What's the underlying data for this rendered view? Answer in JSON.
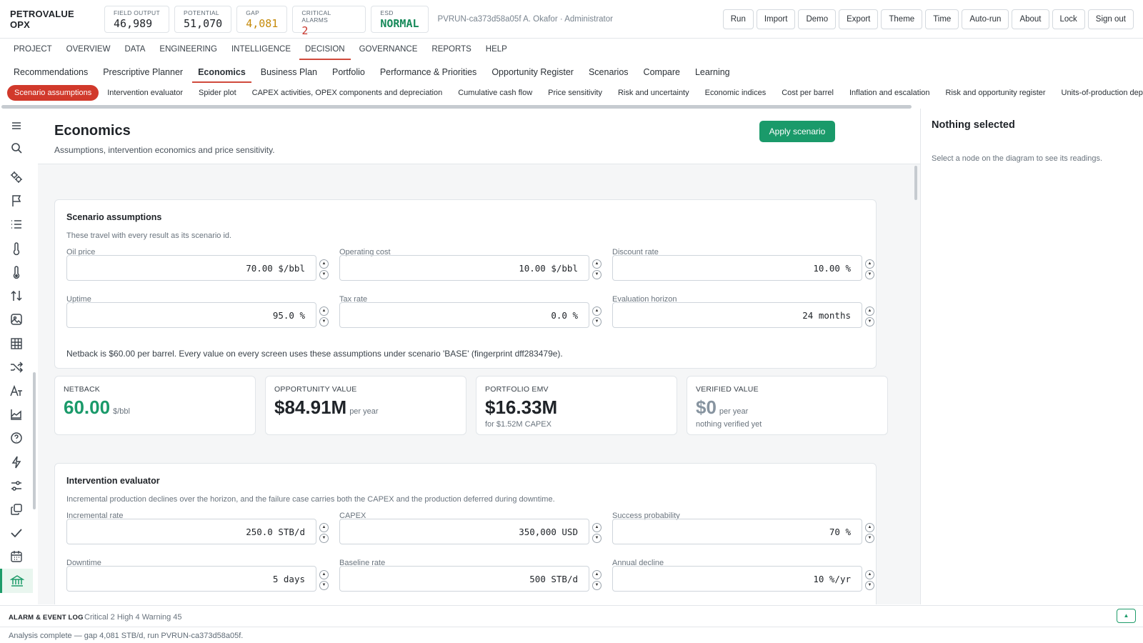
{
  "brand": "PETROVALUE OPX",
  "kpis": [
    {
      "label": "FIELD OUTPUT",
      "value": "46,989",
      "tone": "normal"
    },
    {
      "label": "POTENTIAL",
      "value": "51,070",
      "tone": "normal"
    },
    {
      "label": "GAP",
      "value": "4,081",
      "tone": "amber"
    },
    {
      "label": "CRITICAL ALARMS",
      "value": "2",
      "tone": "red"
    },
    {
      "label": "ESD",
      "value": "NORMAL",
      "tone": "green"
    }
  ],
  "run_info": "PVRUN-ca373d58a05f   A. Okafor · Administrator",
  "top_buttons": [
    "Run",
    "Import",
    "Demo",
    "Export",
    "Theme",
    "Time",
    "Auto-run",
    "About",
    "Lock",
    "Sign out"
  ],
  "nav_primary": [
    "PROJECT",
    "OVERVIEW",
    "DATA",
    "ENGINEERING",
    "INTELLIGENCE",
    "DECISION",
    "GOVERNANCE",
    "REPORTS",
    "HELP"
  ],
  "nav_primary_active": "DECISION",
  "nav_secondary": [
    "Recommendations",
    "Prescriptive Planner",
    "Economics",
    "Business Plan",
    "Portfolio",
    "Performance & Priorities",
    "Opportunity Register",
    "Scenarios",
    "Compare",
    "Learning"
  ],
  "nav_secondary_active": "Economics",
  "nav_tertiary": [
    "Scenario assumptions",
    "Intervention evaluator",
    "Spider plot",
    "CAPEX activities, OPEX components and depreciation",
    "Cumulative cash flow",
    "Price sensitivity",
    "Risk and uncertainty",
    "Economic indices",
    "Cost per barrel",
    "Inflation and escalation",
    "Risk and opportunity register",
    "Units-of-production deprec"
  ],
  "nav_tertiary_active": "Scenario assumptions",
  "rail_icons": [
    "menu-icon",
    "search-icon",
    "gears-icon",
    "flag-icon",
    "list-icon",
    "thermometer-icon",
    "thermometer-alt-icon",
    "transfer-icon",
    "image-icon",
    "table-icon",
    "shuffle-icon",
    "text-style-icon",
    "area-chart-icon",
    "help-icon",
    "bolt-icon",
    "sliders-icon",
    "copy-icon",
    "check-icon",
    "calendar-icon",
    "bank-icon"
  ],
  "rail_active": "bank-icon",
  "page": {
    "title": "Economics",
    "subtitle": "Assumptions, intervention economics and price sensitivity.",
    "apply_label": "Apply scenario"
  },
  "assumptions": {
    "title": "Scenario assumptions",
    "desc": "These travel with every result as its scenario id.",
    "fields": [
      {
        "label": "Oil price",
        "value": "70.00 $/bbl"
      },
      {
        "label": "Operating cost",
        "value": "10.00 $/bbl"
      },
      {
        "label": "Discount rate",
        "value": "10.00 %"
      },
      {
        "label": "Uptime",
        "value": "95.0 %"
      },
      {
        "label": "Tax rate",
        "value": "0.0 %"
      },
      {
        "label": "Evaluation horizon",
        "value": "24 months"
      }
    ],
    "note": "Netback is $60.00 per barrel. Every value on every screen uses these assumptions under scenario 'BASE' (fingerprint dff283479e)."
  },
  "metrics": [
    {
      "label": "NETBACK",
      "value": "60.00",
      "unit": "$/bbl",
      "sub": "",
      "color": "#1a9a6a"
    },
    {
      "label": "OPPORTUNITY VALUE",
      "value": "$84.91M",
      "unit": "per year",
      "sub": "",
      "color": "#1f2328"
    },
    {
      "label": "PORTFOLIO EMV",
      "value": "$16.33M",
      "unit": "",
      "sub": "for $1.52M CAPEX",
      "color": "#1f2328"
    },
    {
      "label": "VERIFIED VALUE",
      "value": "$0",
      "unit": "per year",
      "sub": "nothing verified yet",
      "color": "#8794a0"
    }
  ],
  "evaluator": {
    "title": "Intervention evaluator",
    "desc": "Incremental production declines over the horizon, and the failure case carries both the CAPEX and the production deferred during downtime.",
    "fields": [
      {
        "label": "Incremental rate",
        "value": "250.0 STB/d"
      },
      {
        "label": "CAPEX",
        "value": "350,000 USD"
      },
      {
        "label": "Success probability",
        "value": "70 %"
      },
      {
        "label": "Downtime",
        "value": "5 days"
      },
      {
        "label": "Baseline rate",
        "value": "500 STB/d"
      },
      {
        "label": "Annual decline",
        "value": "10 %/yr"
      }
    ]
  },
  "panel": {
    "title": "Nothing selected",
    "text": "Select a node on the diagram to see its readings."
  },
  "alarm_log": {
    "title": "ALARM & EVENT LOG",
    "counts": "Critical 2  High 4  Warning 45"
  },
  "status": "Analysis complete — gap 4,081 STB/d, run PVRUN-ca373d58a05f."
}
